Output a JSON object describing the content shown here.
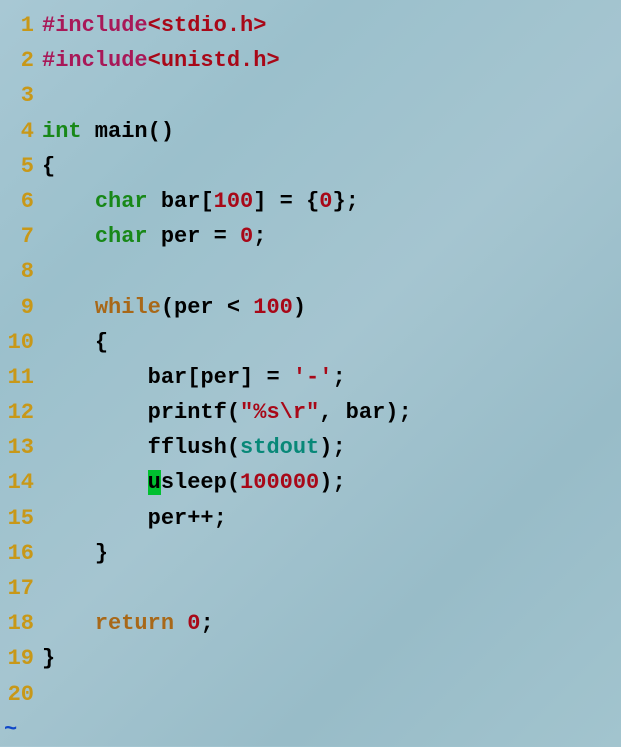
{
  "lines": {
    "l1": "1",
    "l2": "2",
    "l3": "3",
    "l4": "4",
    "l5": "5",
    "l6": "6",
    "l7": "7",
    "l8": "8",
    "l9": "9",
    "l10": "10",
    "l11": "11",
    "l12": "12",
    "l13": "13",
    "l14": "14",
    "l15": "15",
    "l16": "16",
    "l17": "17",
    "l18": "18",
    "l19": "19",
    "l20": "20"
  },
  "tokens": {
    "include1": "#include",
    "stdio": "<stdio.h>",
    "include2": "#include",
    "unistd": "<unistd.h>",
    "int": "int",
    "main": " main",
    "lparen1": "(",
    "rparen1": ")",
    "lbrace1": "{",
    "indent1": "    ",
    "char1": "char",
    "bar_decl": " bar",
    "lbracket1": "[",
    "hundred1": "100",
    "rbracket1": "]",
    "eq1": " = ",
    "lbrace2": "{",
    "zero1": "0",
    "rbrace2": "}",
    "semi1": ";",
    "char2": "char",
    "per_decl": " per ",
    "eq2": "= ",
    "zero2": "0",
    "semi2": ";",
    "while": "while",
    "lparen2": "(",
    "per1": "per ",
    "lt": "< ",
    "hundred2": "100",
    "rparen2": ")",
    "lbrace3": "{",
    "indent2": "        ",
    "bar2": "bar",
    "lbracket2": "[",
    "per2": "per",
    "rbracket2": "]",
    "eq3": " = ",
    "dash_char": "'-'",
    "semi3": ";",
    "printf": "printf",
    "lparen3": "(",
    "fmtstr": "\"%s\\r\"",
    "comma1": ", ",
    "bar3": "bar",
    "rparen3": ")",
    "semi4": ";",
    "fflush": "fflush",
    "lparen4": "(",
    "stdout": "stdout",
    "rparen4": ")",
    "semi5": ";",
    "cursor_u": "u",
    "sleep": "sleep",
    "lparen5": "(",
    "sleeptime": "100000",
    "rparen5": ")",
    "semi6": ";",
    "per3": "per",
    "plusplus": "++",
    "semi7": ";",
    "rbrace3": "}",
    "return": "return",
    "zero3": " 0",
    "semi8": ";",
    "rbrace1": "}",
    "tilde": "~"
  }
}
